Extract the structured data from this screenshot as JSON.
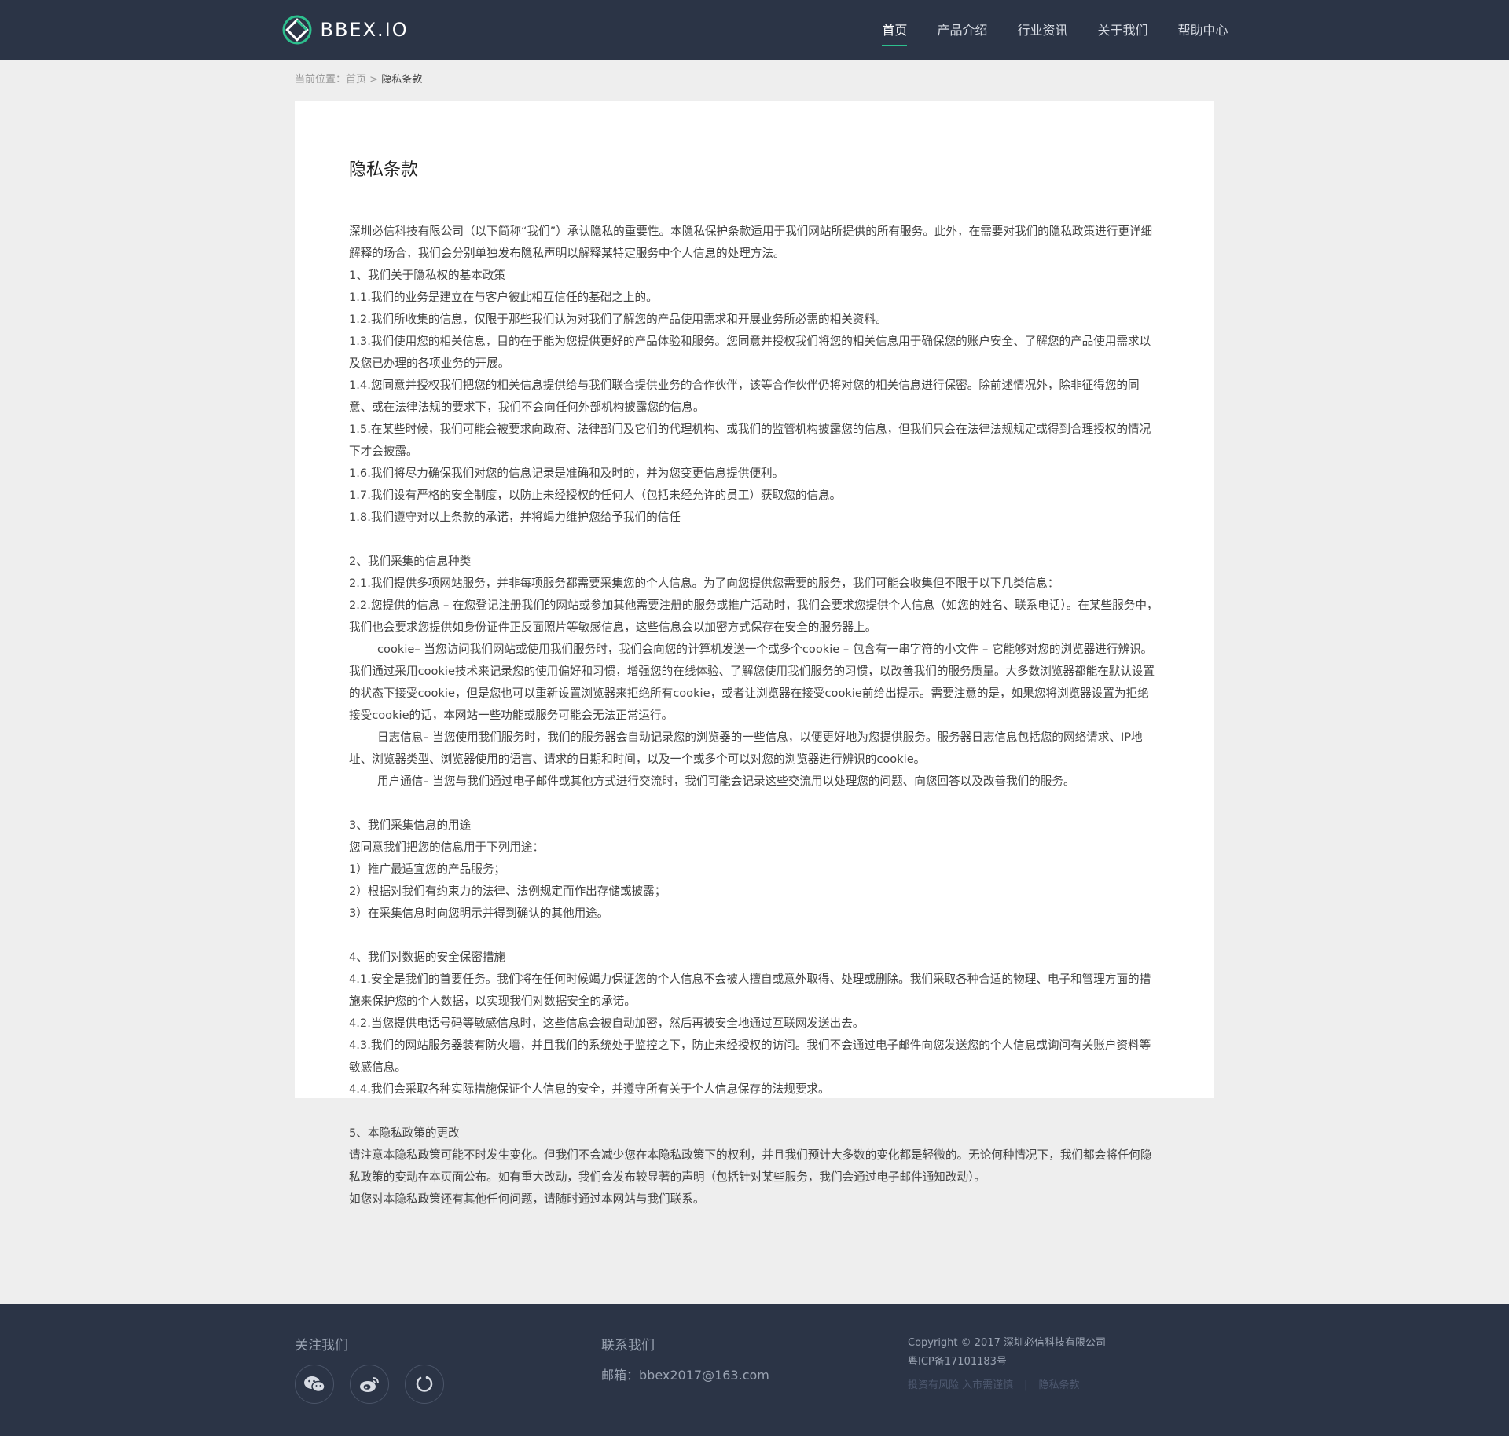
{
  "header": {
    "logo_text": "BBEX.IO",
    "nav": [
      {
        "label": "首页"
      },
      {
        "label": "产品介绍"
      },
      {
        "label": "行业资讯"
      },
      {
        "label": "关于我们"
      },
      {
        "label": "帮助中心"
      }
    ]
  },
  "breadcrumb": {
    "prefix": "当前位置：",
    "home": "首页",
    "sep": " > ",
    "current": "隐私条款"
  },
  "article": {
    "title": "隐私条款",
    "paragraphs": [
      "深圳必信科技有限公司（以下简称“我们”）承认隐私的重要性。本隐私保护条款适用于我们网站所提供的所有服务。此外，在需要对我们的隐私政策进行更详细解释的场合，我们会分别单独发布隐私声明以解释某特定服务中个人信息的处理方法。",
      "1、我们关于隐私权的基本政策",
      "1.1.我们的业务是建立在与客户彼此相互信任的基础之上的。",
      "1.2.我们所收集的信息，仅限于那些我们认为对我们了解您的产品使用需求和开展业务所必需的相关资料。",
      "1.3.我们使用您的相关信息，目的在于能为您提供更好的产品体验和服务。您同意并授权我们将您的相关信息用于确保您的账户安全、了解您的产品使用需求以及您已办理的各项业务的开展。",
      "1.4.您同意并授权我们把您的相关信息提供给与我们联合提供业务的合作伙伴，该等合作伙伴仍将对您的相关信息进行保密。除前述情况外，除非征得您的同意、或在法律法规的要求下，我们不会向任何外部机构披露您的信息。",
      "1.5.在某些时候，我们可能会被要求向政府、法律部门及它们的代理机构、或我们的监管机构披露您的信息，但我们只会在法律法规规定或得到合理授权的情况下才会披露。",
      "1.6.我们将尽力确保我们对您的信息记录是准确和及时的，并为您变更信息提供便利。",
      "1.7.我们设有严格的安全制度，以防止未经授权的任何人（包括未经允许的员工）获取您的信息。",
      "1.8.我们遵守对以上条款的承诺，并将竭力维护您给予我们的信任",
      "",
      "2、我们采集的信息种类",
      "2.1.我们提供多项网站服务，并非每项服务都需要采集您的个人信息。为了向您提供您需要的服务，我们可能会收集但不限于以下几类信息：",
      "2.2.您提供的信息 – 在您登记注册我们的网站或参加其他需要注册的服务或推广活动时，我们会要求您提供个人信息（如您的姓名、联系电话）。在某些服务中，我们也会要求您提供如身份证件正反面照片等敏感信息，这些信息会以加密方式保存在安全的服务器上。",
      ">cookie– 当您访问我们网站或使用我们服务时，我们会向您的计算机发送一个或多个cookie – 包含有一串字符的小文件 – 它能够对您的浏览器进行辨识。我们通过采用cookie技术来记录您的使用偏好和习惯，增强您的在线体验、了解您使用我们服务的习惯，以改善我们的服务质量。大多数浏览器都能在默认设置的状态下接受cookie，但是您也可以重新设置浏览器来拒绝所有cookie，或者让浏览器在接受cookie前给出提示。需要注意的是，如果您将浏览器设置为拒绝接受cookie的话，本网站一些功能或服务可能会无法正常运行。",
      ">日志信息– 当您使用我们服务时，我们的服务器会自动记录您的浏览器的一些信息，以便更好地为您提供服务。服务器日志信息包括您的网络请求、IP地址、浏览器类型、浏览器使用的语言、请求的日期和时间，以及一个或多个可以对您的浏览器进行辨识的cookie。",
      ">用户通信– 当您与我们通过电子邮件或其他方式进行交流时，我们可能会记录这些交流用以处理您的问题、向您回答以及改善我们的服务。",
      "",
      "3、我们采集信息的用途",
      "您同意我们把您的信息用于下列用途：",
      "1）推广最适宜您的产品服务；",
      "2）根据对我们有约束力的法律、法例规定而作出存储或披露；",
      "3）在采集信息时向您明示并得到确认的其他用途。",
      "",
      "4、我们对数据的安全保密措施",
      "4.1.安全是我们的首要任务。我们将在任何时候竭力保证您的个人信息不会被人擅自或意外取得、处理或删除。我们采取各种合适的物理、电子和管理方面的措施来保护您的个人数据，以实现我们对数据安全的承诺。",
      "4.2.当您提供电话号码等敏感信息时，这些信息会被自动加密，然后再被安全地通过互联网发送出去。",
      "4.3.我们的网站服务器装有防火墙，并且我们的系统处于监控之下，防止未经授权的访问。我们不会通过电子邮件向您发送您的个人信息或询问有关账户资料等敏感信息。",
      "4.4.我们会采取各种实际措施保证个人信息的安全，并遵守所有关于个人信息保存的法规要求。",
      "",
      "5、本隐私政策的更改",
      "请注意本隐私政策可能不时发生变化。但我们不会减少您在本隐私政策下的权利，并且我们预计大多数的变化都是轻微的。无论何种情况下，我们都会将任何隐私政策的变动在本页面公布。如有重大改动，我们会发布较显著的声明（包括针对某些服务，我们会通过电子邮件通知改动）。",
      "如您对本隐私政策还有其他任何问题，请随时通过本网站与我们联系。"
    ]
  },
  "footer": {
    "follow_title": "关注我们",
    "social": [
      {
        "icon": "wechat-icon"
      },
      {
        "icon": "weibo-icon"
      },
      {
        "icon": "loop-icon"
      }
    ],
    "contact_title": "联系我们",
    "email": "邮箱：bbex2017@163.com",
    "copyright": "Copyright © 2017 深圳必信科技有限公司",
    "icp": "粤ICP备17101183号",
    "risk_link": "投资有风险 入市需谨慎",
    "link_sep": "|",
    "privacy_link": "隐私条款"
  },
  "colors": {
    "header_bg": "#2b3446",
    "accent": "#2dc08e",
    "page_bg": "#eeeeee"
  }
}
